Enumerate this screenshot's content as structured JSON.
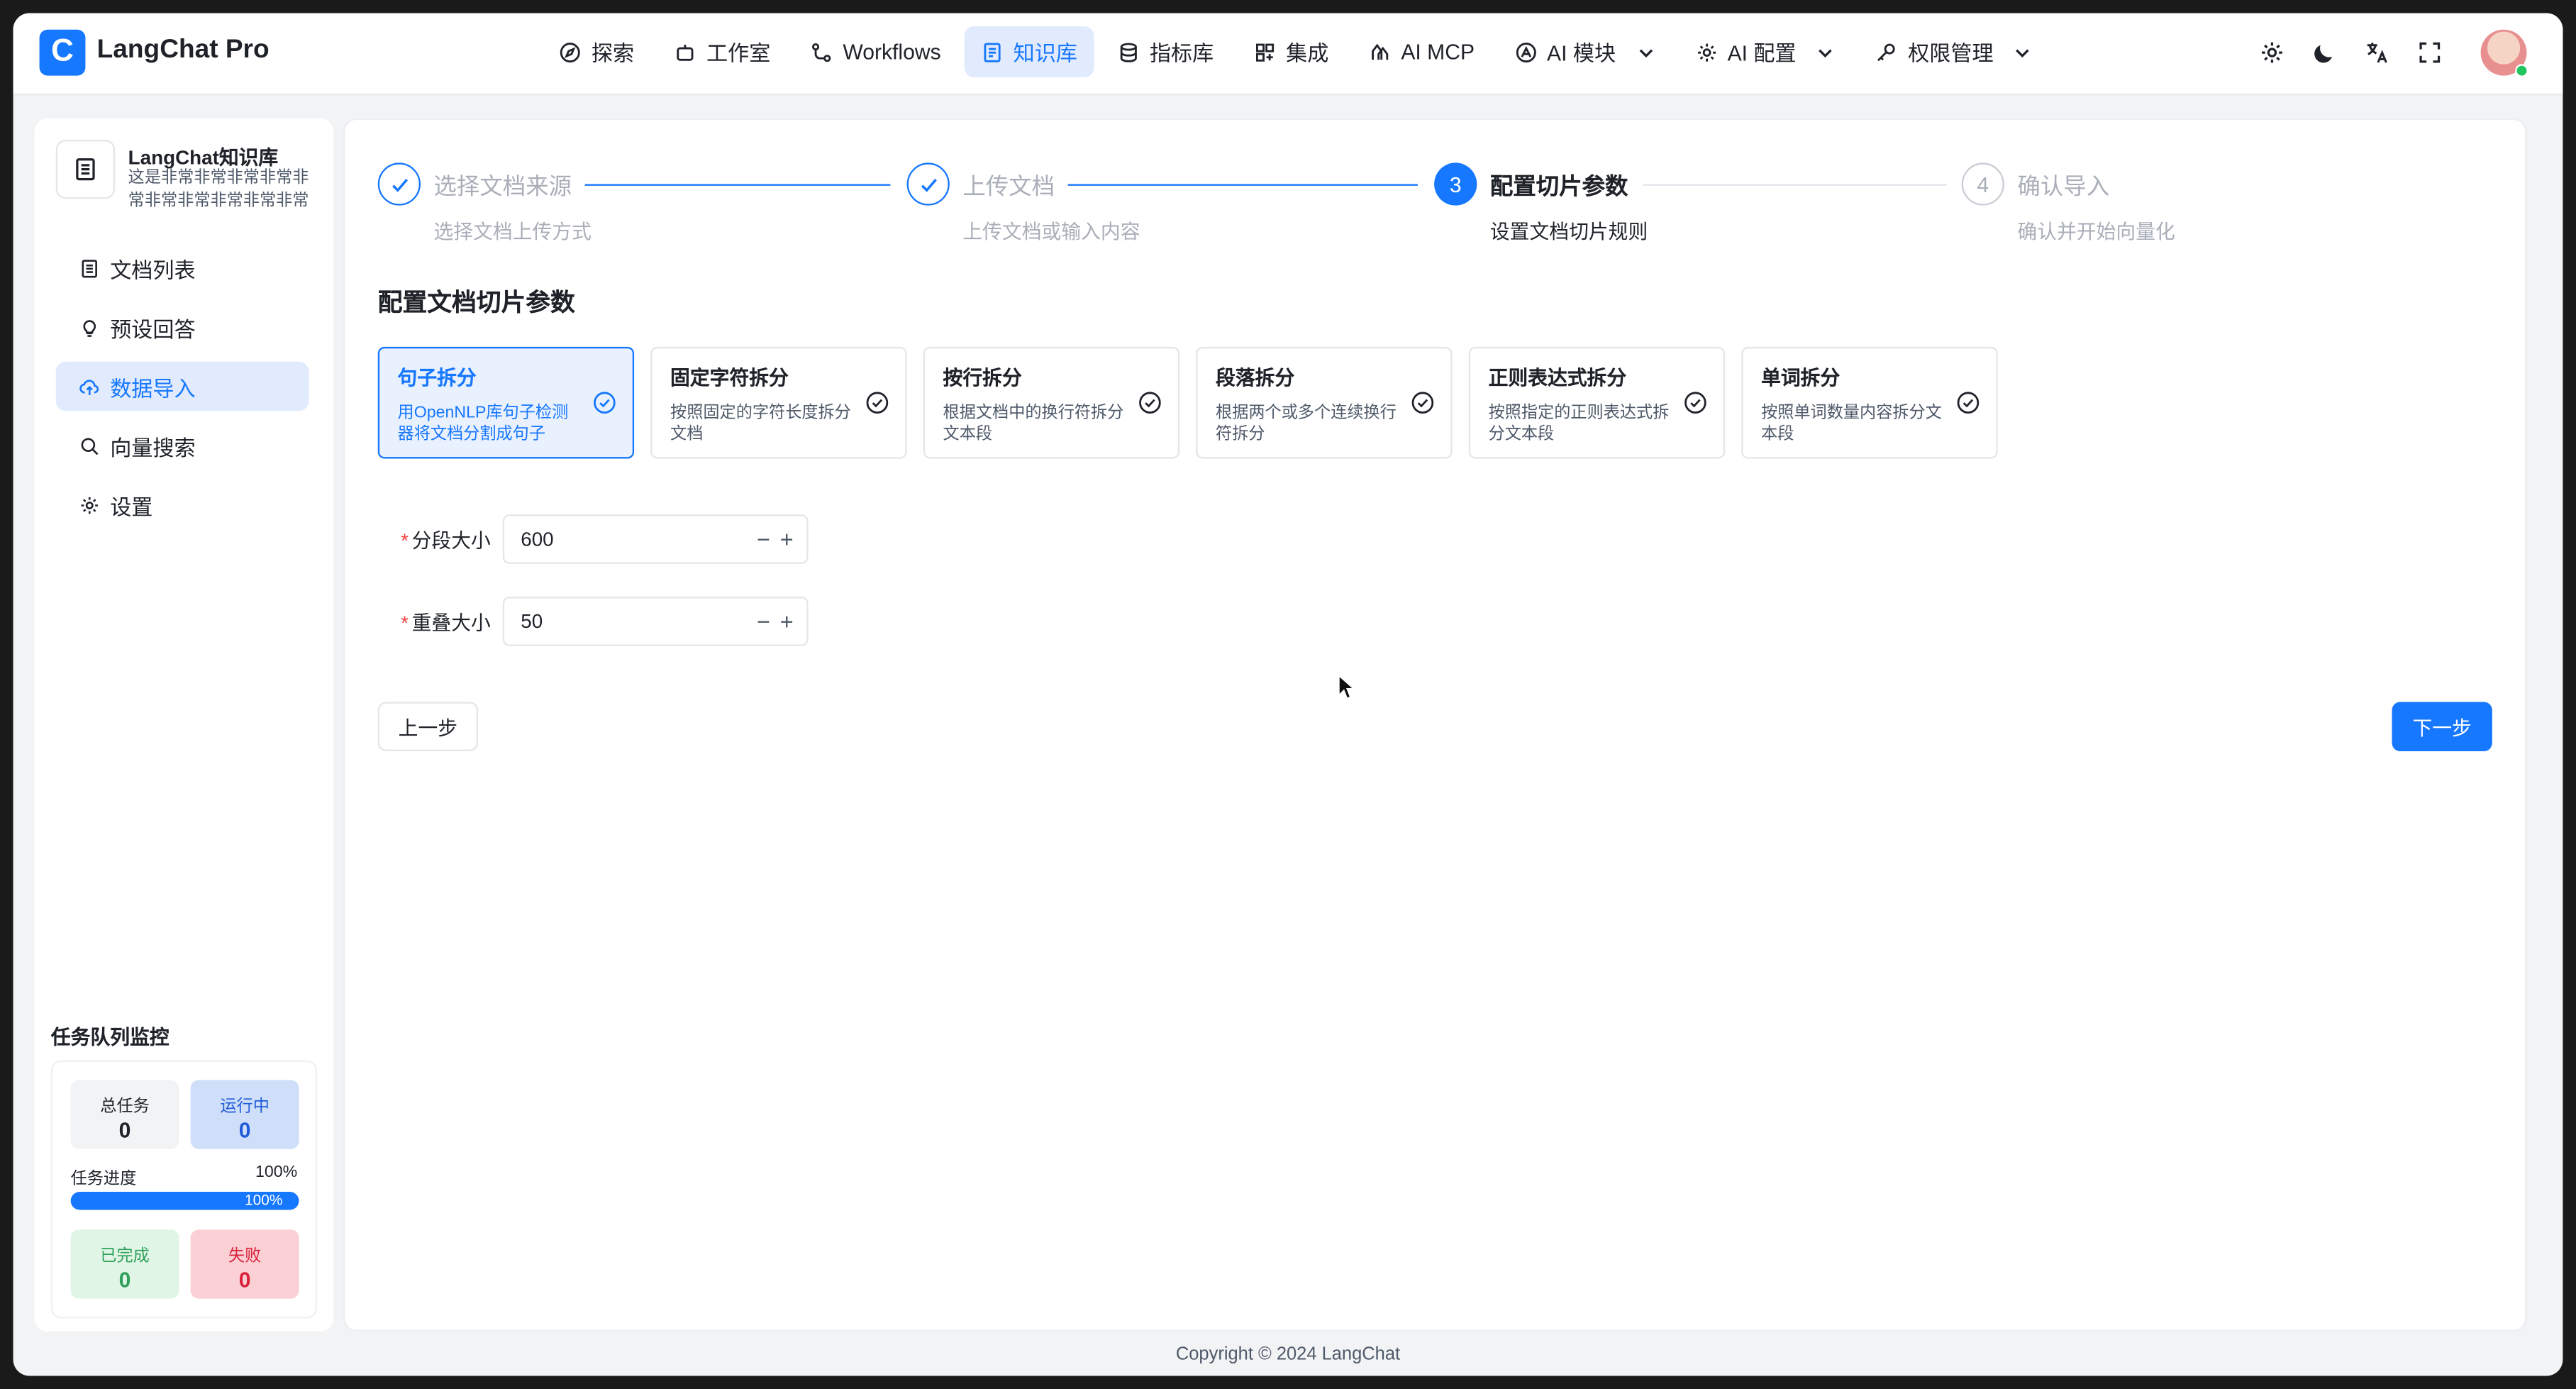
{
  "app": {
    "brand": "LangChat Pro",
    "logo_letter": "C"
  },
  "nav": {
    "items": [
      {
        "label": "探索",
        "icon": "compass-icon"
      },
      {
        "label": "工作室",
        "icon": "robot-icon"
      },
      {
        "label": "Workflows",
        "icon": "workflow-icon"
      },
      {
        "label": "知识库",
        "icon": "book-icon",
        "active": true
      },
      {
        "label": "指标库",
        "icon": "database-icon"
      },
      {
        "label": "集成",
        "icon": "grid-plus-icon"
      },
      {
        "label": "AI MCP",
        "icon": "mcp-icon"
      },
      {
        "label": "AI 模块",
        "icon": "module-icon",
        "dropdown": true
      },
      {
        "label": "AI 配置",
        "icon": "gear-icon",
        "dropdown": true
      },
      {
        "label": "权限管理",
        "icon": "key-icon",
        "dropdown": true
      }
    ]
  },
  "knowledge_base": {
    "title": "LangChat知识库",
    "description": "这是非常非常非常非常非常非常非常非常非常非常非常"
  },
  "sidebar": {
    "items": [
      {
        "label": "文档列表",
        "icon": "document-list-icon"
      },
      {
        "label": "预设回答",
        "icon": "lightbulb-icon"
      },
      {
        "label": "数据导入",
        "icon": "cloud-upload-icon",
        "active": true
      },
      {
        "label": "向量搜索",
        "icon": "search-icon"
      },
      {
        "label": "设置",
        "icon": "gear-icon"
      }
    ]
  },
  "monitor": {
    "title": "任务队列监控",
    "total_label": "总任务",
    "total_value": "0",
    "running_label": "运行中",
    "running_value": "0",
    "progress_label": "任务进度",
    "progress_pct": "100%",
    "progress_value": 1.0,
    "done_label": "已完成",
    "done_value": "0",
    "fail_label": "失败",
    "fail_value": "0"
  },
  "steps": [
    {
      "title": "选择文档来源",
      "desc": "选择文档上传方式",
      "status": "done"
    },
    {
      "title": "上传文档",
      "desc": "上传文档或输入内容",
      "status": "done"
    },
    {
      "title": "配置切片参数",
      "desc": "设置文档切片规则",
      "status": "current",
      "number": "3"
    },
    {
      "title": "确认导入",
      "desc": "确认并开始向量化",
      "status": "wait",
      "number": "4"
    }
  ],
  "section_title": "配置文档切片参数",
  "split_options": [
    {
      "title": "句子拆分",
      "desc": "用OpenNLP库句子检测器将文档分割成句子",
      "selected": true
    },
    {
      "title": "固定字符拆分",
      "desc": "按照固定的字符长度拆分文档"
    },
    {
      "title": "按行拆分",
      "desc": "根据文档中的换行符拆分文本段"
    },
    {
      "title": "段落拆分",
      "desc": "根据两个或多个连续换行符拆分"
    },
    {
      "title": "正则表达式拆分",
      "desc": "按照指定的正则表达式拆分文本段"
    },
    {
      "title": "单词拆分",
      "desc": "按照单词数量内容拆分文本段"
    }
  ],
  "form": {
    "chunk_size_label": "分段大小",
    "chunk_size_value": "600",
    "overlap_label": "重叠大小",
    "overlap_value": "50",
    "required_mark": "*",
    "minus": "−",
    "plus": "+"
  },
  "buttons": {
    "prev": "上一步",
    "next": "下一步"
  },
  "footer": "Copyright © 2024 LangChat",
  "colors": {
    "accent": "#1677ff",
    "danger": "#f53f3f",
    "success": "#2ea05a"
  }
}
